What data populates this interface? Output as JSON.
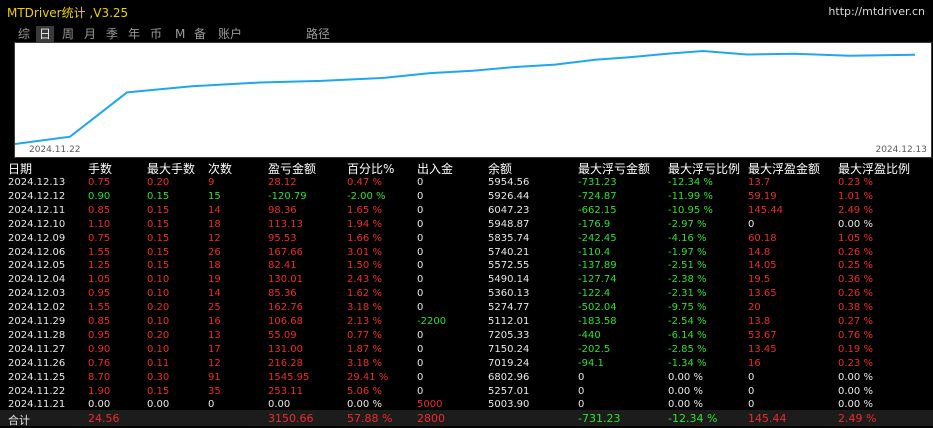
{
  "title": "MTDriver统计 ,V3.25",
  "url": "http://mtdriver.cn",
  "tabs": [
    {
      "label": "综",
      "active": false
    },
    {
      "label": "日",
      "active": true
    },
    {
      "label": "周",
      "active": false
    },
    {
      "label": "月",
      "active": false
    },
    {
      "label": "季",
      "active": false
    },
    {
      "label": "年",
      "active": false
    },
    {
      "label": "币",
      "active": false
    },
    {
      "label": "M",
      "active": false
    },
    {
      "label": "备",
      "active": false
    },
    {
      "label": "账户",
      "active": false
    },
    {
      "label": "路径",
      "active": false
    }
  ],
  "chart_data": {
    "type": "line",
    "x": [
      "2024.11.21",
      "2024.11.22",
      "2024.11.25",
      "2024.11.26",
      "2024.11.27",
      "2024.11.28",
      "2024.11.29",
      "2024.12.02",
      "2024.12.03",
      "2024.12.04",
      "2024.12.05",
      "2024.12.06",
      "2024.12.09",
      "2024.12.10",
      "2024.12.11",
      "2024.12.12",
      "2024.12.13"
    ],
    "series": [
      {
        "values": [
          5003.9,
          5257.01,
          6802.96,
          7019.24,
          7150.24,
          7205.33,
          5112.01,
          5274.77,
          5360.13,
          5490.14,
          5572.55,
          5740.21,
          5835.74,
          5948.87,
          6047.23,
          5926.44,
          5954.56
        ]
      }
    ],
    "x_start_label": "2024.11.22",
    "x_end_label": "2024.12.13",
    "line_color": "#1ea7f0"
  },
  "columns": [
    "日期",
    "手数",
    "最大手数",
    "次数",
    "盈亏金额",
    "百分比%",
    "出入金",
    "余额",
    "最大浮亏金额",
    "最大浮亏比例",
    "最大浮盈金额",
    "最大浮盈比例"
  ],
  "rows": [
    {
      "date": "2024.12.13",
      "lots": "0.75",
      "max_lots": "0.20",
      "count": "9",
      "pnl": "28.12",
      "pct": "0.47 %",
      "deposit": "0",
      "balance": "5954.56",
      "max_dd": "-731.23",
      "max_dd_pct": "-12.34 %",
      "max_fp": "13.7",
      "max_fp_pct": "0.23 %",
      "sign": "r"
    },
    {
      "date": "2024.12.12",
      "lots": "0.90",
      "max_lots": "0.15",
      "count": "15",
      "pnl": "-120.79",
      "pct": "-2.00 %",
      "deposit": "0",
      "balance": "5926.44",
      "max_dd": "-724.87",
      "max_dd_pct": "-11.99 %",
      "max_fp": "59.19",
      "max_fp_pct": "1.01 %",
      "sign": "g"
    },
    {
      "date": "2024.12.11",
      "lots": "0.85",
      "max_lots": "0.15",
      "count": "14",
      "pnl": "98.36",
      "pct": "1.65 %",
      "deposit": "0",
      "balance": "6047.23",
      "max_dd": "-662.15",
      "max_dd_pct": "-10.95 %",
      "max_fp": "145.44",
      "max_fp_pct": "2.49 %",
      "sign": "r"
    },
    {
      "date": "2024.12.10",
      "lots": "1.10",
      "max_lots": "0.15",
      "count": "18",
      "pnl": "113.13",
      "pct": "1.94 %",
      "deposit": "0",
      "balance": "5948.87",
      "max_dd": "-176.9",
      "max_dd_pct": "-2.97 %",
      "max_fp": "0",
      "max_fp_pct": "0.00 %",
      "sign": "r"
    },
    {
      "date": "2024.12.09",
      "lots": "0.75",
      "max_lots": "0.15",
      "count": "12",
      "pnl": "95.53",
      "pct": "1.66 %",
      "deposit": "0",
      "balance": "5835.74",
      "max_dd": "-242.45",
      "max_dd_pct": "-4.16 %",
      "max_fp": "60.18",
      "max_fp_pct": "1.05 %",
      "sign": "r"
    },
    {
      "date": "2024.12.06",
      "lots": "1.55",
      "max_lots": "0.15",
      "count": "26",
      "pnl": "167.66",
      "pct": "3.01 %",
      "deposit": "0",
      "balance": "5740.21",
      "max_dd": "-110.4",
      "max_dd_pct": "-1.97 %",
      "max_fp": "14.8",
      "max_fp_pct": "0.26 %",
      "sign": "r"
    },
    {
      "date": "2024.12.05",
      "lots": "1.25",
      "max_lots": "0.15",
      "count": "18",
      "pnl": "82.41",
      "pct": "1.50 %",
      "deposit": "0",
      "balance": "5572.55",
      "max_dd": "-137.89",
      "max_dd_pct": "-2.51 %",
      "max_fp": "14.05",
      "max_fp_pct": "0.25 %",
      "sign": "r"
    },
    {
      "date": "2024.12.04",
      "lots": "1.05",
      "max_lots": "0.10",
      "count": "19",
      "pnl": "130.01",
      "pct": "2.43 %",
      "deposit": "0",
      "balance": "5490.14",
      "max_dd": "-127.74",
      "max_dd_pct": "-2.38 %",
      "max_fp": "19.5",
      "max_fp_pct": "0.36 %",
      "sign": "r"
    },
    {
      "date": "2024.12.03",
      "lots": "0.95",
      "max_lots": "0.10",
      "count": "14",
      "pnl": "85.36",
      "pct": "1.62 %",
      "deposit": "0",
      "balance": "5360.13",
      "max_dd": "-122.4",
      "max_dd_pct": "-2.31 %",
      "max_fp": "13.65",
      "max_fp_pct": "0.26 %",
      "sign": "r"
    },
    {
      "date": "2024.12.02",
      "lots": "1.55",
      "max_lots": "0.20",
      "count": "25",
      "pnl": "162.76",
      "pct": "3.18 %",
      "deposit": "0",
      "balance": "5274.77",
      "max_dd": "-502.04",
      "max_dd_pct": "-9.75 %",
      "max_fp": "20",
      "max_fp_pct": "0.38 %",
      "sign": "r"
    },
    {
      "date": "2024.11.29",
      "lots": "0.85",
      "max_lots": "0.10",
      "count": "16",
      "pnl": "106.68",
      "pct": "2.13 %",
      "deposit": "-2200",
      "balance": "5112.01",
      "max_dd": "-183.58",
      "max_dd_pct": "-2.54 %",
      "max_fp": "13.8",
      "max_fp_pct": "0.27 %",
      "sign": "r",
      "dep_green": true
    },
    {
      "date": "2024.11.28",
      "lots": "0.95",
      "max_lots": "0.20",
      "count": "13",
      "pnl": "55.09",
      "pct": "0.77 %",
      "deposit": "0",
      "balance": "7205.33",
      "max_dd": "-440",
      "max_dd_pct": "-6.14 %",
      "max_fp": "53.67",
      "max_fp_pct": "0.76 %",
      "sign": "r"
    },
    {
      "date": "2024.11.27",
      "lots": "0.90",
      "max_lots": "0.10",
      "count": "17",
      "pnl": "131.00",
      "pct": "1.87 %",
      "deposit": "0",
      "balance": "7150.24",
      "max_dd": "-202.5",
      "max_dd_pct": "-2.85 %",
      "max_fp": "13.45",
      "max_fp_pct": "0.19 %",
      "sign": "r"
    },
    {
      "date": "2024.11.26",
      "lots": "0.76",
      "max_lots": "0.11",
      "count": "12",
      "pnl": "216.28",
      "pct": "3.18 %",
      "deposit": "0",
      "balance": "7019.24",
      "max_dd": "-94.1",
      "max_dd_pct": "-1.34 %",
      "max_fp": "16",
      "max_fp_pct": "0.23 %",
      "sign": "r"
    },
    {
      "date": "2024.11.25",
      "lots": "8.70",
      "max_lots": "0.30",
      "count": "91",
      "pnl": "1545.95",
      "pct": "29.41 %",
      "deposit": "0",
      "balance": "6802.96",
      "max_dd": "0",
      "max_dd_pct": "0.00 %",
      "max_fp": "0",
      "max_fp_pct": "0.00 %",
      "sign": "r"
    },
    {
      "date": "2024.11.22",
      "lots": "1.90",
      "max_lots": "0.15",
      "count": "35",
      "pnl": "253.11",
      "pct": "5.06 %",
      "deposit": "0",
      "balance": "5257.01",
      "max_dd": "0",
      "max_dd_pct": "0.00 %",
      "max_fp": "0",
      "max_fp_pct": "0.00 %",
      "sign": "r"
    },
    {
      "date": "2024.11.21",
      "lots": "0.00",
      "max_lots": "0.00",
      "count": "0",
      "pnl": "0.00",
      "pct": "0.00 %",
      "deposit": "5000",
      "balance": "5003.90",
      "max_dd": "0",
      "max_dd_pct": "0.00 %",
      "max_fp": "0",
      "max_fp_pct": "0.00 %",
      "sign": "w",
      "dep_red": true
    }
  ],
  "total": {
    "label": "合计",
    "lots": "24.56",
    "pnl": "3150.66",
    "pct": "57.88 %",
    "deposit": "2800",
    "max_dd": "-731.23",
    "max_dd_pct": "-12.34 %",
    "max_fp": "145.44",
    "max_fp_pct": "2.49 %"
  }
}
